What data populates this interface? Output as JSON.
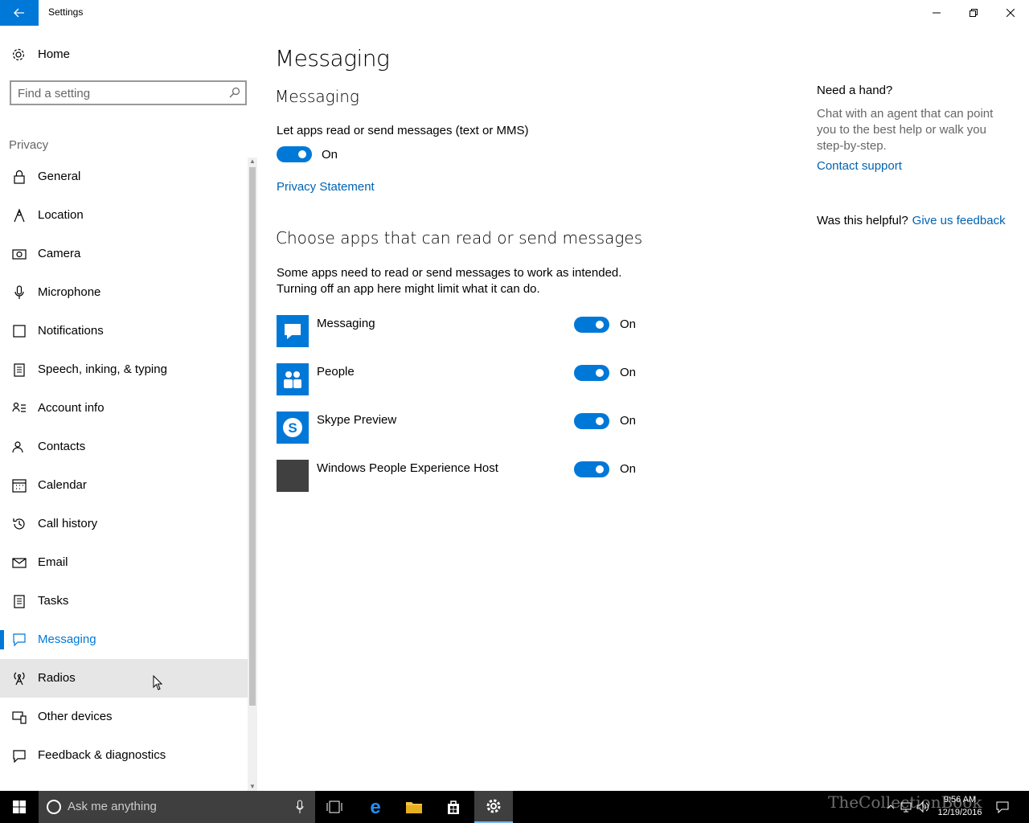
{
  "window": {
    "title": "Settings",
    "icons": {
      "back": "back-arrow-icon",
      "minimize": "minimize-icon",
      "maximize": "restore-icon",
      "close": "close-icon"
    }
  },
  "sidebar": {
    "home_label": "Home",
    "search_placeholder": "Find a setting",
    "section_label": "Privacy",
    "items": [
      {
        "label": "General",
        "icon": "lock-icon"
      },
      {
        "label": "Location",
        "icon": "location-icon"
      },
      {
        "label": "Camera",
        "icon": "camera-icon"
      },
      {
        "label": "Microphone",
        "icon": "microphone-icon"
      },
      {
        "label": "Notifications",
        "icon": "notifications-icon"
      },
      {
        "label": "Speech, inking, & typing",
        "icon": "speech-icon"
      },
      {
        "label": "Account info",
        "icon": "account-icon"
      },
      {
        "label": "Contacts",
        "icon": "contacts-icon"
      },
      {
        "label": "Calendar",
        "icon": "calendar-icon"
      },
      {
        "label": "Call history",
        "icon": "history-icon"
      },
      {
        "label": "Email",
        "icon": "email-icon"
      },
      {
        "label": "Tasks",
        "icon": "tasks-icon"
      },
      {
        "label": "Messaging",
        "icon": "message-icon"
      },
      {
        "label": "Radios",
        "icon": "radio-icon"
      },
      {
        "label": "Other devices",
        "icon": "devices-icon"
      },
      {
        "label": "Feedback & diagnostics",
        "icon": "feedback-icon"
      }
    ],
    "active_index": 12,
    "hover_index": 13
  },
  "main": {
    "page_title": "Messaging",
    "sub_title": "Messaging",
    "master_desc": "Let apps read or send messages (text or MMS)",
    "master_toggle_label": "On",
    "privacy_link": "Privacy Statement",
    "apps_title": "Choose apps that can read or send messages",
    "apps_desc_line1": "Some apps need to read or send messages to work as intended.",
    "apps_desc_line2": "Turning off an app here might limit what it can do.",
    "apps": [
      {
        "name": "Messaging",
        "state": "On",
        "icon": "messaging-app-icon",
        "color": "#0078d7"
      },
      {
        "name": "People",
        "state": "On",
        "icon": "people-app-icon",
        "color": "#0078d7"
      },
      {
        "name": "Skype Preview",
        "state": "On",
        "icon": "skype-app-icon",
        "color": "#0078d7"
      },
      {
        "name": "Windows People Experience Host",
        "state": "On",
        "icon": "generic-app-icon",
        "color": "#404040"
      }
    ]
  },
  "help": {
    "title": "Need a hand?",
    "body": "Chat with an agent that can point you to the best help or walk you step-by-step.",
    "link": "Contact support",
    "helpful_q": "Was this helpful?",
    "feedback_link": "Give us feedback"
  },
  "taskbar": {
    "search_text": "Ask me anything",
    "time": "9:56 AM",
    "date": "12/19/2016",
    "watermark": "TheCollectionBook"
  },
  "colors": {
    "accent": "#0078d7",
    "link": "#0063b1"
  }
}
